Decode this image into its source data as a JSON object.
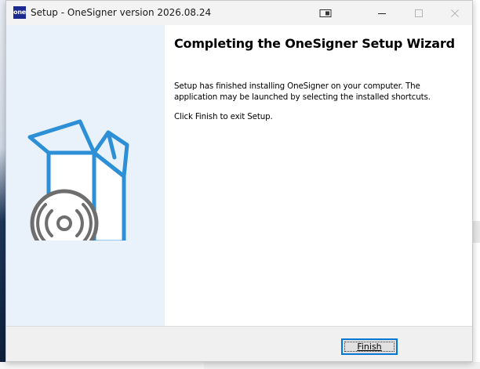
{
  "window": {
    "app_icon_text": "one",
    "title": "Setup - OneSigner version 2026.08.24"
  },
  "content": {
    "heading": "Completing the OneSigner Setup Wizard",
    "paragraph1": "Setup has finished installing OneSigner on your computer. The application may be launched by selecting the installed shortcuts.",
    "paragraph2": "Click Finish to exit Setup."
  },
  "footer": {
    "finish_label": "Finish"
  },
  "icons": {
    "app": "onesigner-app-icon",
    "titlebar_extra": "window-snap-icon",
    "minimize": "minimize-icon",
    "maximize": "maximize-icon",
    "close": "close-icon",
    "illustration": "software-box-disc-icon"
  },
  "colors": {
    "accent": "#0078d4",
    "illustration_blue": "#2d8fd6",
    "illustration_gray": "#6e6e6e",
    "sidebar": "#e9f2fb",
    "app_icon_bg": "#1b2b8f"
  }
}
